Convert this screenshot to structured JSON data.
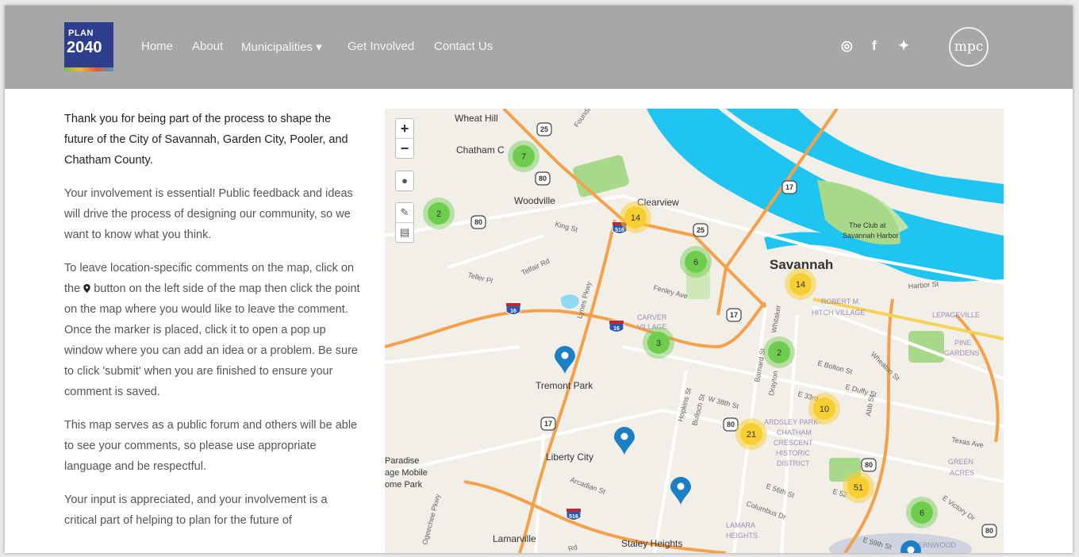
{
  "logo": {
    "line1": "PLAN",
    "line2": "2040"
  },
  "nav": {
    "home": "Home",
    "about": "About",
    "municipalities": "Municipalities ▾",
    "get_involved": "Get Involved",
    "contact": "Contact Us"
  },
  "social": {
    "instagram": "◎",
    "facebook": "f",
    "twitter": "✦"
  },
  "brand_mark": "mpc",
  "intro": {
    "lead": "Thank you for being part of the process to shape the future of the City of Savannah, Garden City, Pooler, and Chatham County.",
    "p1": "Your involvement is essential! Public feedback and ideas will drive the process of designing our community, so we want to know what you think.",
    "p2_before": "To leave location-specific comments on the map, click on the",
    "p2_after": "button on the left side of the map then click the point on the map where you would like to leave the comment. Once the marker is placed, click it to open a pop up window where you can add an idea or a problem. Be sure to click 'submit' when you are finished to ensure your comment is saved.",
    "p3": "This map serves as a public forum and others will be able to see your comments, so please use appropriate language and be respectful.",
    "p4": "Your input is appreciated, and your involvement is a critical part of helping to plan for the future of"
  },
  "map": {
    "controls": {
      "zoom_in": "+",
      "zoom_out": "−",
      "marker": "●",
      "edit": "✎",
      "delete": "▤"
    },
    "places": {
      "wheat_hill": "Wheat Hill",
      "chatham": "Chatham C",
      "woodville": "Woodville",
      "clearview": "Clearview",
      "savannah": "Savannah",
      "club": "The Club at",
      "club2": "Savannah Harbor",
      "tremont": "Tremont Park",
      "liberty": "Liberty City",
      "lamarville": "Lamarville",
      "staley": "Staley Heights",
      "paradise1": "Paradise",
      "paradise2": "age Mobile",
      "paradise3": "ome Park",
      "carver1": "CARVER",
      "carver2": "VILLAGE",
      "robert1": "ROBERT M.",
      "robert2": "HITCH VILLAGE",
      "lepage": "LEPAGEVILLE",
      "pine1": "PINE",
      "pine2": "GARDENS",
      "ardsley1": "ARDSLEY PARK-",
      "ardsley2": "CHATHAM",
      "ardsley3": "CRESCENT",
      "ardsley4": "HISTORIC",
      "ardsley5": "DISTRICT",
      "green1": "GREEN",
      "green2": "ACRES",
      "lamara1": "LAMARA",
      "lamara2": "HEIGHTS",
      "ernwood": "ERNWOOD"
    },
    "streets": {
      "king": "King St",
      "telfair": "Telfair Rd",
      "teller": "Teller Pl",
      "fenley": "Fenley Ave",
      "lynes": "Lynes Pkwy",
      "harbor": "Harbor St",
      "whitaker": "Whitaker",
      "e_bolton": "E Bolton St",
      "e_duffy": "E Duffy St",
      "e_33rd": "E 33rd",
      "w_38th": "W 38th St",
      "hopkins": "Hopkins St",
      "bulloch": "Bulloch St",
      "barnard": "Barnard St",
      "drayton": "Drayton",
      "waters": "Wheaton St",
      "abb": "Abb St",
      "texas": "Texas Ave",
      "e_victory": "E Victory Dr",
      "e_56th": "E 56th St",
      "e_52": "E 52",
      "columbus": "Columbus Dr",
      "e_59th": "E 59th St",
      "arcadian": "Arcadian St",
      "rd": "Rd",
      "ogeechee": "Ogeechee Pkwy",
      "foundation": "Foundation"
    },
    "shields": {
      "s25": "25",
      "s80a": "80",
      "s80b": "80",
      "s25b": "25",
      "s17a": "17",
      "s17b": "17",
      "s17c": "17",
      "s80c": "80",
      "s80d": "80",
      "i516a": "516",
      "i516b": "516",
      "i16a": "16",
      "i16b": "16",
      "s80e": "80"
    },
    "clusters": [
      {
        "id": "c1",
        "count": "7",
        "tier": "green"
      },
      {
        "id": "c2",
        "count": "2",
        "tier": "green"
      },
      {
        "id": "c3",
        "count": "14",
        "tier": "yellow"
      },
      {
        "id": "c4",
        "count": "6",
        "tier": "green"
      },
      {
        "id": "c5",
        "count": "14",
        "tier": "yellow"
      },
      {
        "id": "c6",
        "count": "3",
        "tier": "green"
      },
      {
        "id": "c7",
        "count": "2",
        "tier": "green"
      },
      {
        "id": "c8",
        "count": "10",
        "tier": "yellow"
      },
      {
        "id": "c9",
        "count": "21",
        "tier": "yellow"
      },
      {
        "id": "c10",
        "count": "51",
        "tier": "yellow"
      },
      {
        "id": "c11",
        "count": "6",
        "tier": "green"
      }
    ]
  },
  "colors": {
    "nav_bg": "#a7a7a7",
    "water": "#1fc5f0",
    "park": "#a8d98a",
    "highway": "#f5a04a",
    "cluster_green": "#6fcd4e",
    "cluster_yellow": "#f7cf30",
    "marker": "#1b7fc4"
  }
}
